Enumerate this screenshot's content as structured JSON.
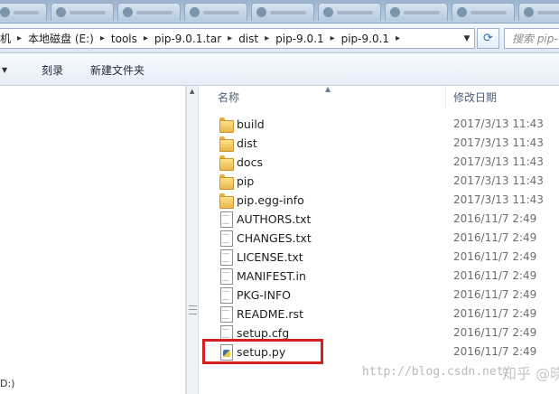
{
  "address_bar": {
    "crumbs": [
      "机",
      "本地磁盘 (E:)",
      "tools",
      "pip-9.0.1.tar",
      "dist",
      "pip-9.0.1",
      "pip-9.0.1"
    ]
  },
  "search": {
    "placeholder": "搜索 pip-"
  },
  "toolbar": {
    "burn_label": "刻录",
    "new_folder_label": "新建文件夹"
  },
  "nav_pane": {
    "partial_text": "D:)"
  },
  "columns": {
    "name": "名称",
    "date": "修改日期"
  },
  "files": [
    {
      "name": "build",
      "type": "folder",
      "date": "2017/3/13 11:43"
    },
    {
      "name": "dist",
      "type": "folder",
      "date": "2017/3/13 11:43"
    },
    {
      "name": "docs",
      "type": "folder",
      "date": "2017/3/13 11:43"
    },
    {
      "name": "pip",
      "type": "folder",
      "date": "2017/3/13 11:43"
    },
    {
      "name": "pip.egg-info",
      "type": "folder",
      "date": "2017/3/13 11:43"
    },
    {
      "name": "AUTHORS.txt",
      "type": "file",
      "date": "2016/11/7 2:49"
    },
    {
      "name": "CHANGES.txt",
      "type": "file",
      "date": "2016/11/7 2:49"
    },
    {
      "name": "LICENSE.txt",
      "type": "file",
      "date": "2016/11/7 2:49"
    },
    {
      "name": "MANIFEST.in",
      "type": "file",
      "date": "2016/11/7 2:49"
    },
    {
      "name": "PKG-INFO",
      "type": "file",
      "date": "2016/11/7 2:49"
    },
    {
      "name": "README.rst",
      "type": "file",
      "date": "2016/11/7 2:49"
    },
    {
      "name": "setup.cfg",
      "type": "file",
      "date": "2016/11/7 2:49"
    },
    {
      "name": "setup.py",
      "type": "python-file",
      "date": "2016/11/7 2:49"
    }
  ],
  "highlighted_file": "setup.py",
  "watermark": {
    "url": "http://blog.csdn.net/",
    "brand": "知乎 @晓软"
  },
  "colors": {
    "highlight": "#d31f1f",
    "folder": "#eab64c",
    "date_text": "#6d6d6d"
  }
}
